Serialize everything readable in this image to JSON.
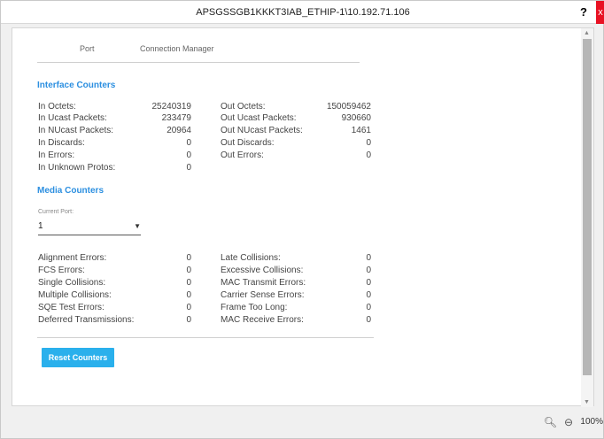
{
  "window": {
    "title": "APSGSSGB1KKKT3IAB_ETHIP-1\\10.192.71.106",
    "help_label": "?",
    "close_label": "x"
  },
  "tabs": [
    {
      "label": "Port"
    },
    {
      "label": "Connection Manager"
    }
  ],
  "interface_counters": {
    "title": "Interface Counters",
    "left": [
      {
        "label": "In Octets:",
        "value": "25240319"
      },
      {
        "label": "In Ucast Packets:",
        "value": "233479"
      },
      {
        "label": "In NUcast Packets:",
        "value": "20964"
      },
      {
        "label": "In Discards:",
        "value": "0"
      },
      {
        "label": "In Errors:",
        "value": "0"
      },
      {
        "label": "In Unknown Protos:",
        "value": "0"
      }
    ],
    "right": [
      {
        "label": "Out Octets:",
        "value": "150059462"
      },
      {
        "label": "Out Ucast Packets:",
        "value": "930660"
      },
      {
        "label": "Out NUcast Packets:",
        "value": "1461"
      },
      {
        "label": "Out Discards:",
        "value": "0"
      },
      {
        "label": "Out Errors:",
        "value": "0"
      }
    ]
  },
  "media_counters": {
    "title": "Media Counters",
    "current_port_label": "Current Port:",
    "current_port_value": "1",
    "left": [
      {
        "label": "Alignment Errors:",
        "value": "0"
      },
      {
        "label": "FCS Errors:",
        "value": "0"
      },
      {
        "label": "Single Collisions:",
        "value": "0"
      },
      {
        "label": "Multiple Collisions:",
        "value": "0"
      },
      {
        "label": "SQE Test Errors:",
        "value": "0"
      },
      {
        "label": "Deferred Transmissions:",
        "value": "0"
      }
    ],
    "right": [
      {
        "label": "Late Collisions:",
        "value": "0"
      },
      {
        "label": "Excessive Collisions:",
        "value": "0"
      },
      {
        "label": "MAC Transmit Errors:",
        "value": "0"
      },
      {
        "label": "Carrier Sense Errors:",
        "value": "0"
      },
      {
        "label": "Frame Too Long:",
        "value": "0"
      },
      {
        "label": "MAC Receive Errors:",
        "value": "0"
      }
    ]
  },
  "actions": {
    "reset_label": "Reset Counters"
  },
  "footer": {
    "zoom_level": "100%"
  },
  "colors": {
    "accent": "#2c8fe0",
    "button": "#2ab0ec",
    "close": "#e81123"
  },
  "icons": {
    "zoom_in": "zoom-in-icon",
    "zoom_out": "zoom-out-icon",
    "dropdown": "chevron-down-icon"
  }
}
